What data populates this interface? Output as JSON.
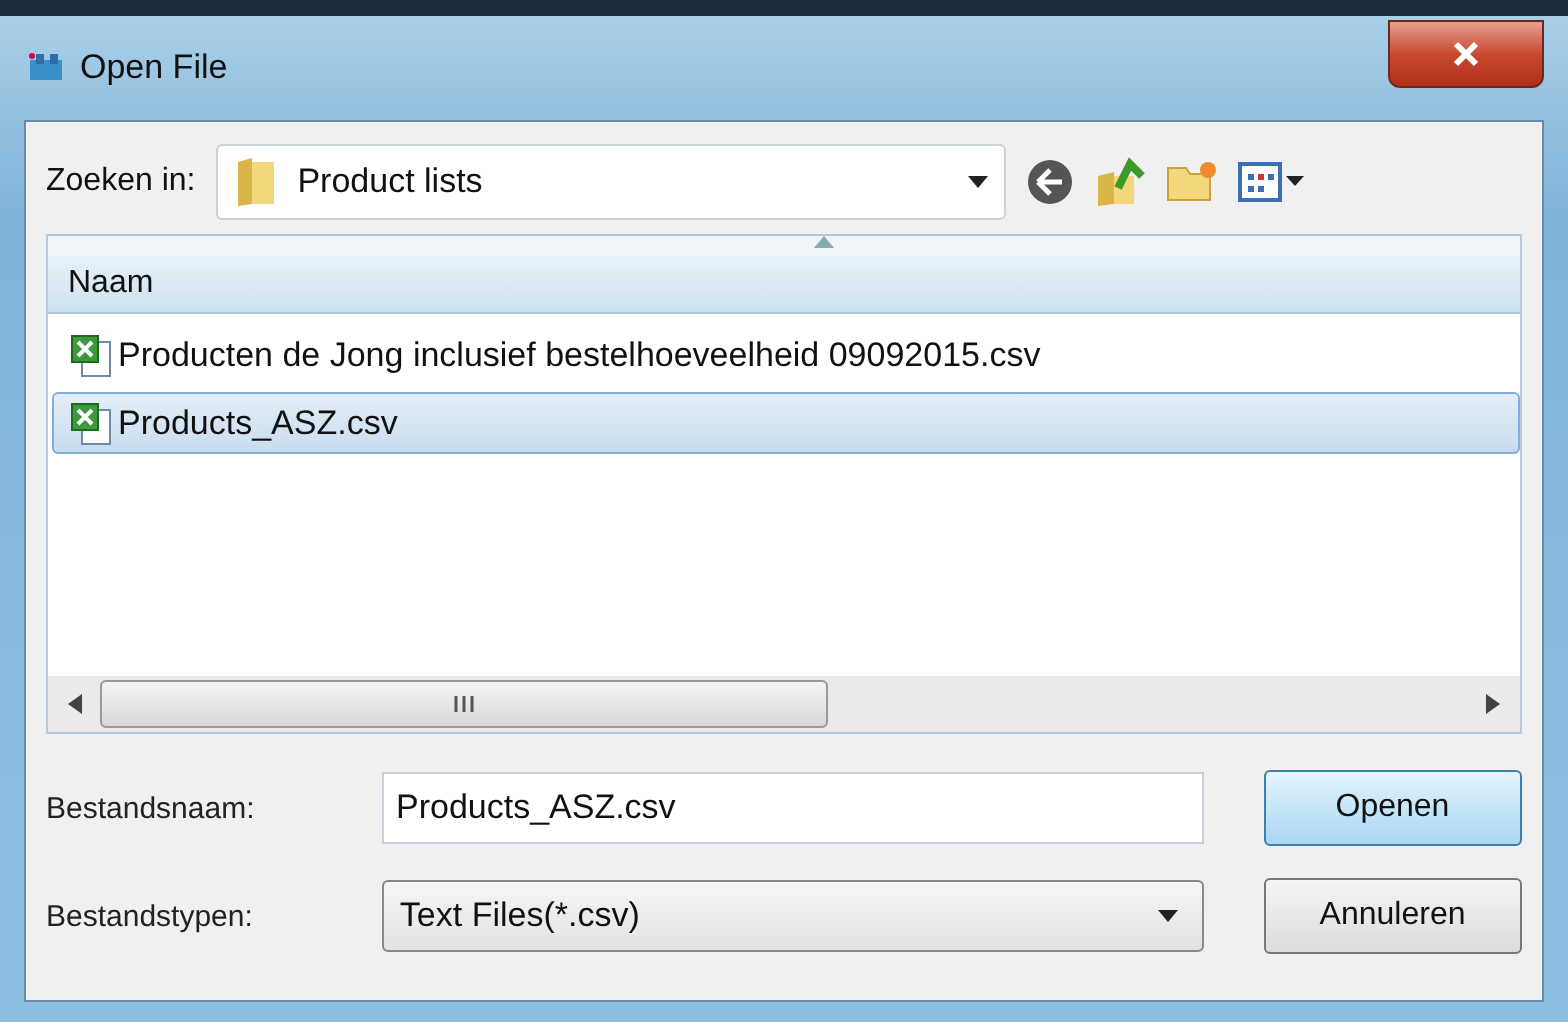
{
  "window": {
    "title": "Open File"
  },
  "look_in": {
    "label": "Zoeken in:",
    "value": "Product lists"
  },
  "file_list": {
    "columns": [
      "Naam"
    ],
    "rows": [
      {
        "name": "Producten de Jong inclusief bestelhoeveelheid 09092015.csv",
        "selected": false
      },
      {
        "name": "Products_ASZ.csv",
        "selected": true
      }
    ]
  },
  "file_name": {
    "label": "Bestandsnaam:",
    "value": "Products_ASZ.csv"
  },
  "file_type": {
    "label": "Bestandstypen:",
    "value": "Text Files(*.csv)"
  },
  "buttons": [
    {
      "label": "Openen",
      "kind": "default"
    },
    {
      "label": "Annuleren",
      "kind": "normal"
    }
  ]
}
